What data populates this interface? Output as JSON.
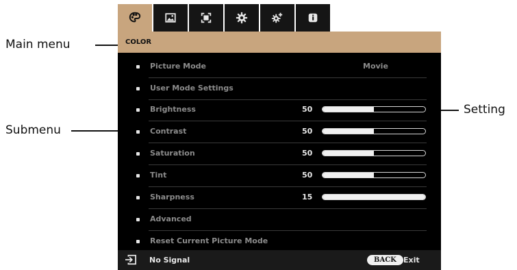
{
  "callouts": {
    "main_menu": "Main menu",
    "submenu": "Submenu",
    "setting": "Setting"
  },
  "tabs": [
    {
      "icon": "palette-icon",
      "active": true
    },
    {
      "icon": "image-icon",
      "active": false
    },
    {
      "icon": "screen-fit-icon",
      "active": false
    },
    {
      "icon": "gear-icon",
      "active": false
    },
    {
      "icon": "advanced-gear-icon",
      "active": false
    },
    {
      "icon": "info-icon",
      "active": false
    }
  ],
  "menu": {
    "title": "COLOR",
    "items": [
      {
        "label": "Picture Mode",
        "value": "Movie"
      },
      {
        "label": "User Mode Settings"
      },
      {
        "label": "Brightness",
        "number": "50",
        "level": 0.5
      },
      {
        "label": "Contrast",
        "number": "50",
        "level": 0.5
      },
      {
        "label": "Saturation",
        "number": "50",
        "level": 0.5
      },
      {
        "label": "Tint",
        "number": "50",
        "level": 0.5
      },
      {
        "label": "Sharpness",
        "number": "15",
        "level": 1.0
      },
      {
        "label": "Advanced"
      },
      {
        "label": "Reset Current Picture Mode"
      }
    ]
  },
  "footer": {
    "icon": "input-source-icon",
    "status": "No Signal",
    "back_label": "BACK",
    "exit_label": "Exit"
  },
  "colors": {
    "accent": "#c8a57e",
    "panel": "#000000",
    "tab": "#151515"
  }
}
